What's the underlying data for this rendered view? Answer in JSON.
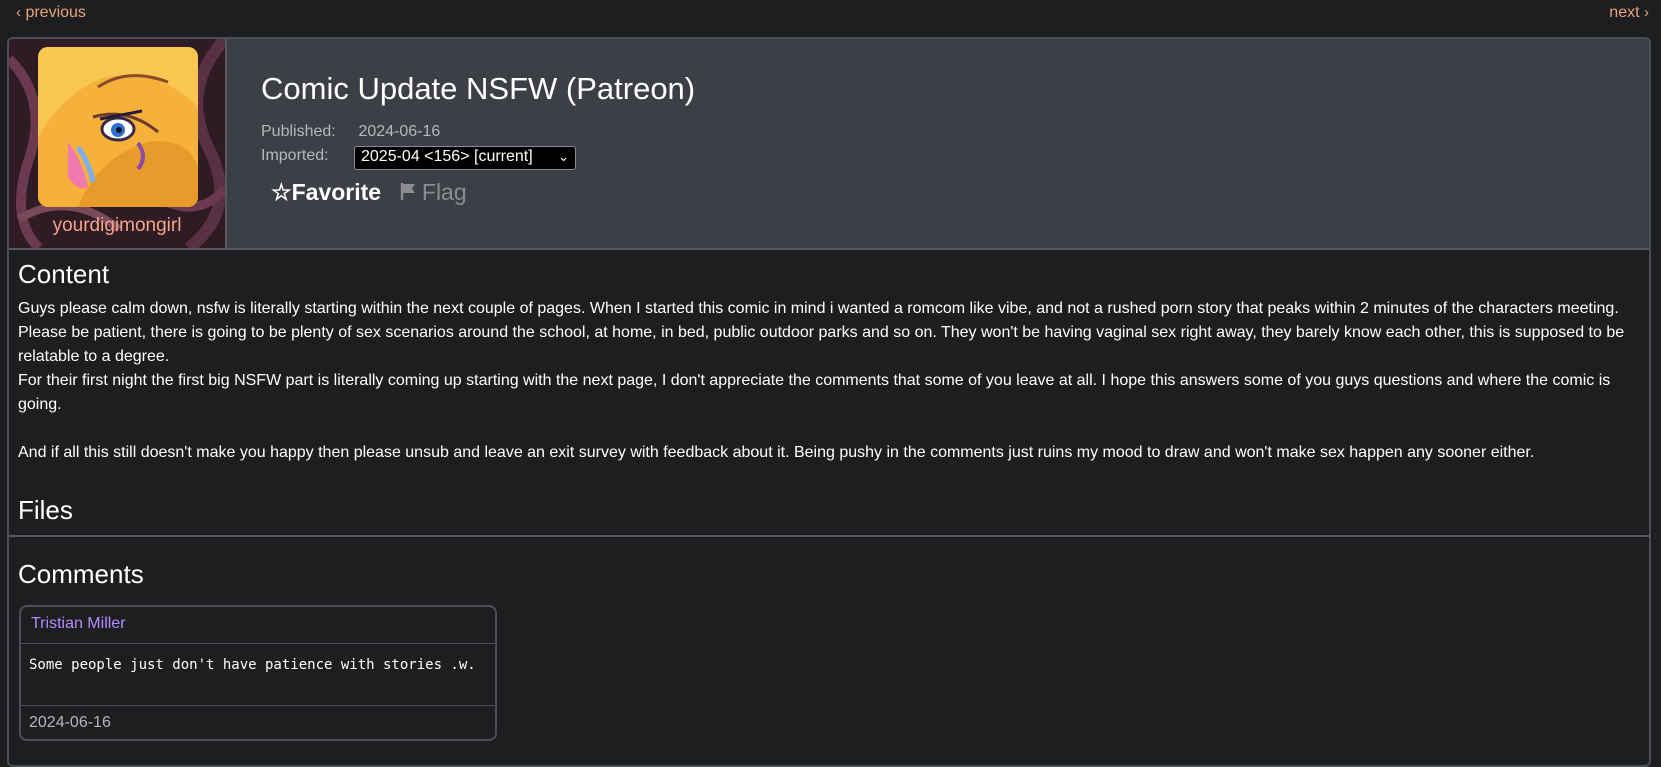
{
  "nav": {
    "previous_label": "previous",
    "next_label": "next"
  },
  "post": {
    "title": "Comic Update NSFW (Patreon)",
    "username": "yourdigimongirl",
    "published_label": "Published:",
    "published_value": "2024-06-16",
    "imported_label": "Imported:",
    "imported_selected": "2025-04 <156> [current]",
    "favorite_label": "Favorite",
    "flag_label": "Flag"
  },
  "sections": {
    "content_heading": "Content",
    "files_heading": "Files",
    "comments_heading": "Comments"
  },
  "content": {
    "paragraph1": "Guys please calm down, nsfw is literally starting within the next couple of pages. When I started this comic in mind i wanted a romcom like vibe, and not a rushed porn story that peaks within 2 minutes of the characters meeting. Please be patient, there is going to be plenty of sex scenarios around the school, at home, in bed, public outdoor parks and so on. They won't be having vaginal sex right away, they barely know each other, this is supposed to be relatable to a degree.",
    "paragraph2": "For their first night the first big NSFW part is literally coming up starting with the next page, I don't appreciate the comments that some of you leave at all. I hope this answers some of you guys questions and where the comic is going.",
    "paragraph3": "And if all this still doesn't make you happy then please unsub and leave an exit survey with feedback about it. Being pushy in the comments just ruins my mood to draw and won't make sex happen any sooner either."
  },
  "comments": [
    {
      "author": "Tristian Miller",
      "text": "Some people just don't have patience with stories .w.",
      "date": "2024-06-16"
    }
  ],
  "colors": {
    "accent_link": "#e8a37b",
    "header_bg": "#3d3f47",
    "page_bg": "#1d1e20",
    "comment_author": "#b38bff"
  },
  "icons": {
    "favorite": "star-outline-icon",
    "flag": "flag-icon",
    "select": "chevron-down-icon"
  }
}
